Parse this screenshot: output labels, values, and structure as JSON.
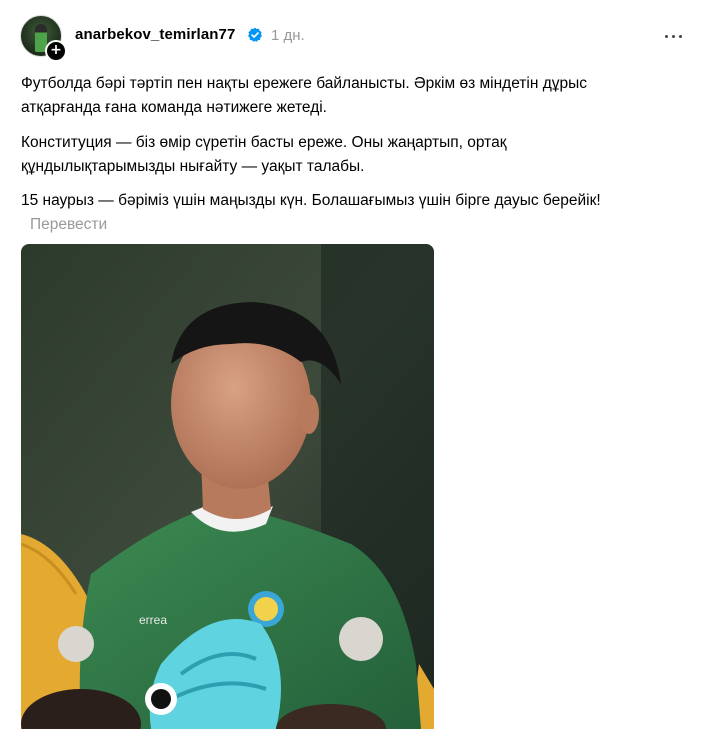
{
  "post": {
    "username": "anarbekov_temirlan77",
    "timestamp": "1 дн.",
    "follow_symbol": "+",
    "paragraphs": [
      "Футболда бәрі тәртіп пен нақты ережеге байланысты. Әркім өз міндетін дұрыс атқарғанда ғана команда нәтижеге жетеді.",
      "Конституция — біз өмір сүретін басты ереже. Оны жаңартып, ортақ құндылықтарымызды нығайту — уақыт талабы.",
      "15 наурыз — бәріміз үшін маңызды күн. Болашағымыз үшін бірге дауыс берейік!"
    ],
    "translate_label": "Перевести",
    "icons": {
      "verified": "verified-badge-icon",
      "more": "more-options-icon",
      "follow": "follow-plus-icon"
    },
    "photo": {
      "jersey_brand": "errea"
    }
  },
  "colors": {
    "text": "#000000",
    "muted": "#999999",
    "verified_blue": "#0095f6",
    "jersey_green": "#2f7a45",
    "glove_cyan": "#5fd3e0"
  }
}
